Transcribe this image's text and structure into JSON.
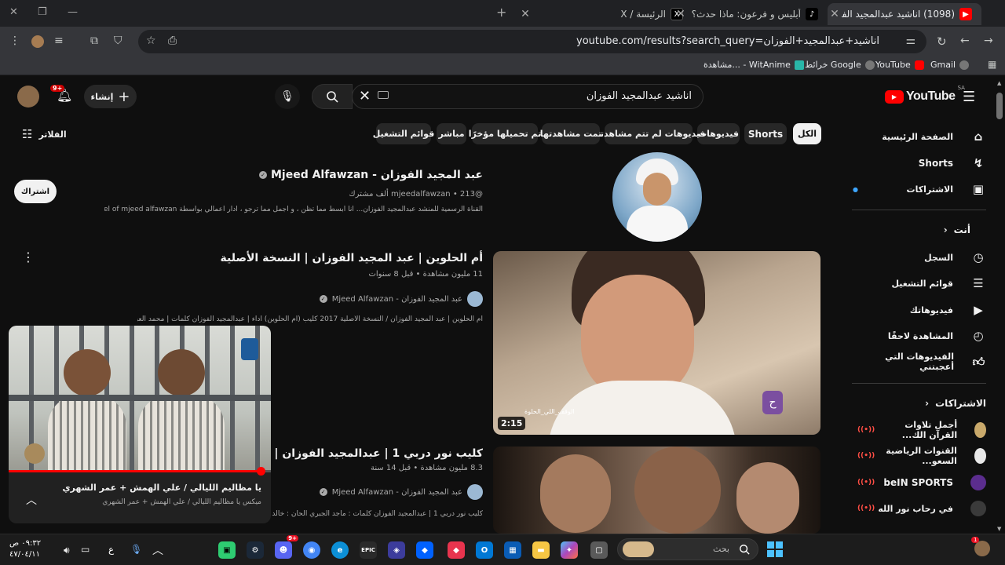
{
  "browser": {
    "tabs": [
      {
        "title": "(1098) اناشيد عبدالمجيد الفوزان -",
        "active": true
      },
      {
        "title": "أبليس و فرعون: ماذا حدث؟ | TikTok",
        "active": false
      },
      {
        "title": "الرئيسة / X",
        "active": false
      }
    ],
    "new_tab": "+",
    "url": "youtube.com/results?search_query=اناشيد+عبدالمجيد+الفوزان",
    "bookmarks": [
      "Gmail",
      "YouTube",
      "خرائط Google",
      "مشاهدة... - WitAnime"
    ]
  },
  "youtube": {
    "logo": "YouTube",
    "region": "SA",
    "search_query": "اناشيد عبدالمجيد الفوزان",
    "create_label": "إنشاء",
    "notifications_badge": "9+",
    "filters_label": "الفلاتر",
    "chips": [
      "الكل",
      "Shorts",
      "فيديوهات",
      "فيديوهات لم تتم مشاهدتها",
      "تمت مشاهدتها",
      "تم تحميلها مؤخرًا",
      "مباشر",
      "قوائم التشغيل"
    ],
    "sidebar": {
      "main": [
        {
          "label": "الصفحة الرئيسية",
          "icon": "home-icon"
        },
        {
          "label": "Shorts",
          "icon": "shorts-icon"
        },
        {
          "label": "الاشتراكات",
          "icon": "subscriptions-icon"
        }
      ],
      "you_header": "أنت",
      "you": [
        {
          "label": "السجل",
          "icon": "history-icon"
        },
        {
          "label": "قوائم التشغيل",
          "icon": "playlists-icon"
        },
        {
          "label": "فيديوهاتك",
          "icon": "your-videos-icon"
        },
        {
          "label": "المشاهدة لاحقًا",
          "icon": "watch-later-icon"
        },
        {
          "label": "الفيديوهات التي أعجبتني",
          "icon": "liked-icon"
        }
      ],
      "subs_header": "الاشتراكات",
      "subscriptions": [
        {
          "label": "أجمل تلاوات القرآن الك...",
          "live": true,
          "color": "#c9a96b"
        },
        {
          "label": "القنوات الرياضية السعو...",
          "live": true,
          "color": "#e8e8e8"
        },
        {
          "label": "beIN SPORTS",
          "live": true,
          "color": "#5b2d8e"
        },
        {
          "label": "في رحاب نور الله",
          "live": true,
          "color": "#3a3a3a"
        }
      ]
    },
    "channel_result": {
      "name": "عبد المجيد الفوزان - Mjeed Alfawzan",
      "handle": "@mjeedalfawzan",
      "subscribers": "213 ألف مشترك",
      "description": "القناة الرسمية للمنشد عبدالمجيد الفوزان... أنا أبسط مما تظن ، و أجمل مما ترجو ، أدار أعمالي بواسطة Official channel of mjeed alfawzan -",
      "subscribe_label": "اشتراك"
    },
    "videos": [
      {
        "title": "أم الحلوين | عبد المجيد الفوزان | النسخة الأصلية",
        "views": "11 مليون مشاهدة",
        "age": "قبل 8 سنوات",
        "channel": "عبد المجيد الفوزان - Mjeed Alfawzan",
        "description": "أم الحلوين | عبد المجيد الفوزان / النسخة الأصلية 2017 كليب (أم الحلوين) أداء | عبدالمجيد الفوزان كلمات | محمد العبدالكريم ألحان / م...",
        "duration": "2:15",
        "caption": "الوقف_اللي_الحلوة"
      },
      {
        "title": "كليب نور دربي 1 | عبدالمجيد الفوزان | HD",
        "views": "8.3 مليون مشاهدة",
        "age": "قبل 14 سنة",
        "channel": "عبد المجيد الفوزان - Mjeed Alfawzan",
        "description": "كليب نور دربي 1 | عبدالمجيد الفوزان كلمات : ماجد الجبري ألحان : خالد زاهر منتج منفذ"
      }
    ],
    "miniplayer": {
      "title": "يا مظاليم الليالي / علي الهمش + عمر الشهري",
      "subtitle": "ميكس يا مظاليم الليالي / علي الهمش + عمر الشهري",
      "progress": 0.96
    }
  },
  "taskbar": {
    "search_placeholder": "بحث",
    "time": "٠٩:٣٢ ص",
    "date": "٤٧/٠٤/١١",
    "lang": "ع",
    "discord_badge": "9+",
    "notif_badge": "1"
  }
}
